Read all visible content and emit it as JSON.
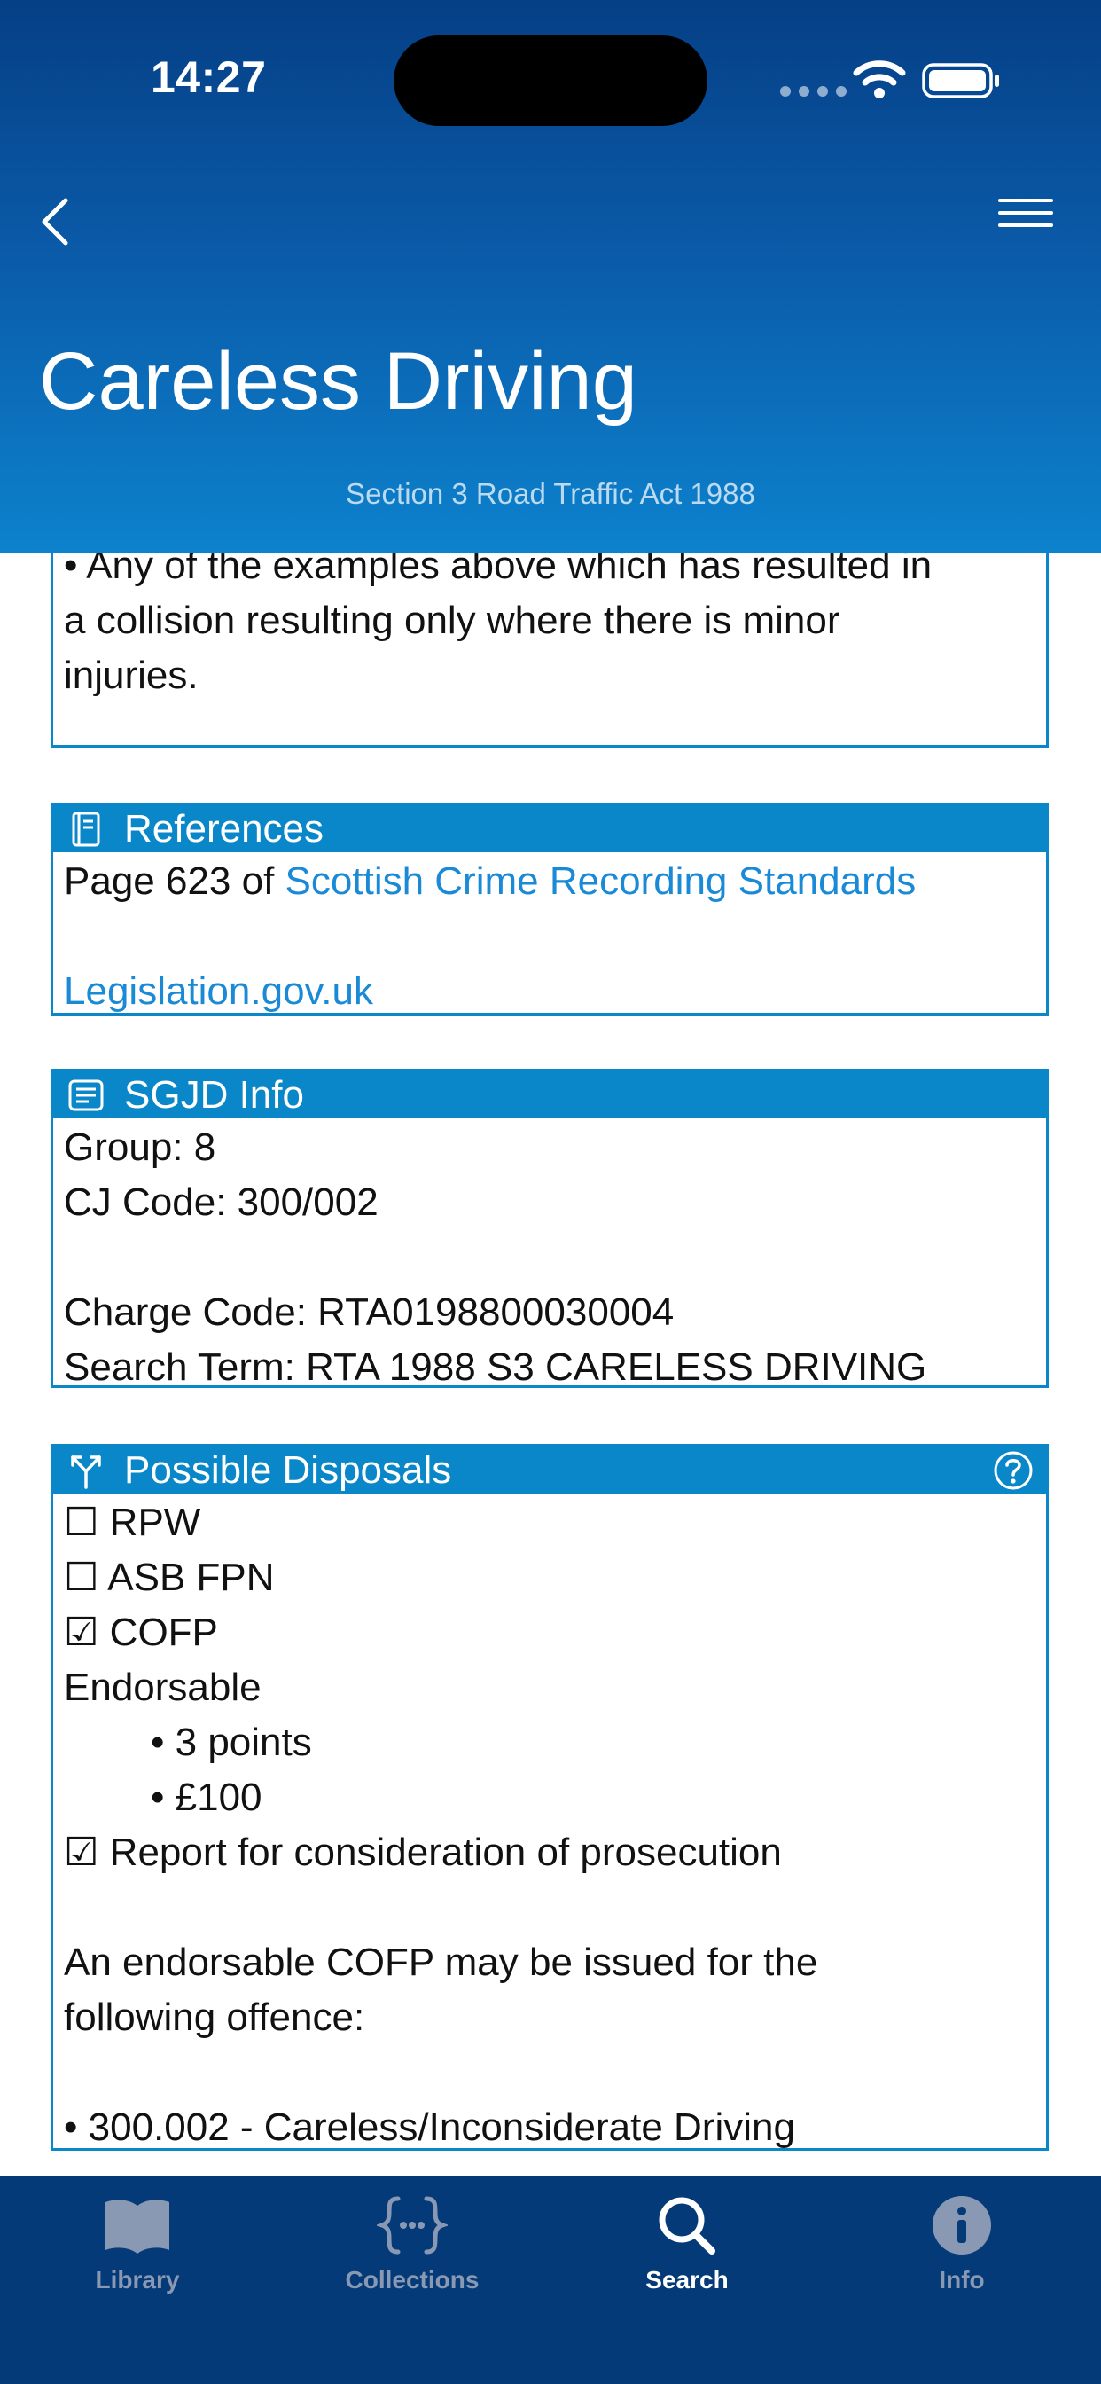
{
  "status_bar": {
    "time": "14:27"
  },
  "header": {
    "title": "Careless Driving",
    "subtitle": "Section 3 Road Traffic Act 1988"
  },
  "top_card": {
    "lines": [
      "• Any of the examples above which has resulted in",
      "a collision resulting only where there is minor",
      "injuries."
    ]
  },
  "references": {
    "title": "References",
    "page_prefix": "Page 623 of ",
    "scrs_link": "Scottish Crime Recording Standards",
    "legislation_link": "Legislation.gov.uk"
  },
  "sgjd": {
    "title": "SGJD Info",
    "group": "Group: 8",
    "cj_code": "CJ Code: 300/002",
    "charge_code": "Charge Code: RTA0198800030004",
    "search_term": "Search Term: RTA 1988 S3 CARELESS DRIVING"
  },
  "disposals": {
    "title": "Possible Disposals",
    "rpw": "☐ RPW",
    "asb_fpn": "☐ ASB FPN",
    "cofp": "☑ COFP",
    "endorsable": "Endorsable",
    "points": "• 3 points",
    "fine": "• £100",
    "report": "☑ Report for consideration of prosecution",
    "note_line1": "An endorsable COFP may be issued for the",
    "note_line2": "following offence:",
    "offence": "• 300.002 - Careless/Inconsiderate Driving"
  },
  "tabbar": {
    "tabs": [
      {
        "label": "Library",
        "icon": "book-icon",
        "active": false
      },
      {
        "label": "Collections",
        "icon": "braces-icon",
        "active": false
      },
      {
        "label": "Search",
        "icon": "search-icon",
        "active": true
      },
      {
        "label": "Info",
        "icon": "info-icon",
        "active": false
      }
    ]
  },
  "colors": {
    "header_top": "#053f85",
    "header_bottom": "#0d82cd",
    "card_accent": "#0a87c8",
    "link": "#1a8ad6",
    "tabbar": "#053a78"
  }
}
